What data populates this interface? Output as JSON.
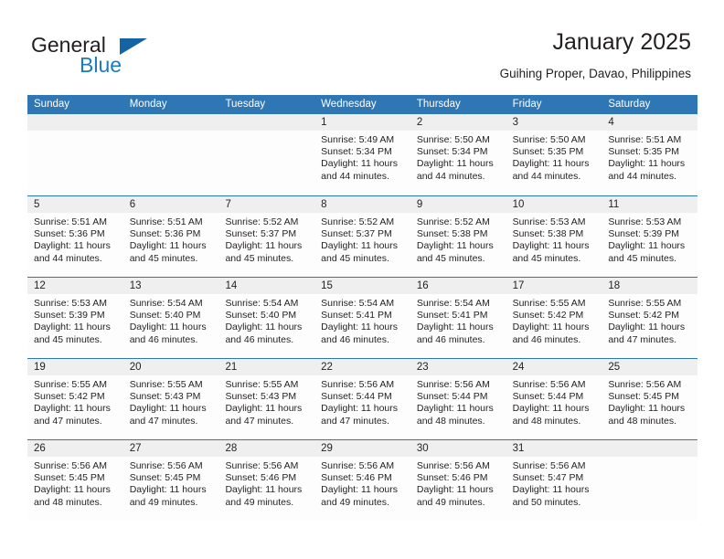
{
  "logo": {
    "word_one": "General",
    "word_two": "Blue",
    "mark": "triangle-icon"
  },
  "header": {
    "title": "January 2025",
    "subtitle": "Guihing Proper, Davao, Philippines"
  },
  "calendar": {
    "weekdays": [
      "Sunday",
      "Monday",
      "Tuesday",
      "Wednesday",
      "Thursday",
      "Friday",
      "Saturday"
    ],
    "labels": {
      "sunrise": "Sunrise:",
      "sunset": "Sunset:",
      "daylight": "Daylight:"
    },
    "colors": {
      "header_blue": "#2f76b5",
      "day_number_bar": "#efefef",
      "text": "#231f20",
      "logo_blue": "#1c7ac0"
    },
    "weeks": [
      [
        {
          "day": "",
          "empty": true
        },
        {
          "day": "",
          "empty": true
        },
        {
          "day": "",
          "empty": true
        },
        {
          "day": "1",
          "sunrise": "Sunrise: 5:49 AM",
          "sunset": "Sunset: 5:34 PM",
          "daylight": "Daylight: 11 hours and 44 minutes."
        },
        {
          "day": "2",
          "sunrise": "Sunrise: 5:50 AM",
          "sunset": "Sunset: 5:34 PM",
          "daylight": "Daylight: 11 hours and 44 minutes."
        },
        {
          "day": "3",
          "sunrise": "Sunrise: 5:50 AM",
          "sunset": "Sunset: 5:35 PM",
          "daylight": "Daylight: 11 hours and 44 minutes."
        },
        {
          "day": "4",
          "sunrise": "Sunrise: 5:51 AM",
          "sunset": "Sunset: 5:35 PM",
          "daylight": "Daylight: 11 hours and 44 minutes."
        }
      ],
      [
        {
          "day": "5",
          "sunrise": "Sunrise: 5:51 AM",
          "sunset": "Sunset: 5:36 PM",
          "daylight": "Daylight: 11 hours and 44 minutes."
        },
        {
          "day": "6",
          "sunrise": "Sunrise: 5:51 AM",
          "sunset": "Sunset: 5:36 PM",
          "daylight": "Daylight: 11 hours and 45 minutes."
        },
        {
          "day": "7",
          "sunrise": "Sunrise: 5:52 AM",
          "sunset": "Sunset: 5:37 PM",
          "daylight": "Daylight: 11 hours and 45 minutes."
        },
        {
          "day": "8",
          "sunrise": "Sunrise: 5:52 AM",
          "sunset": "Sunset: 5:37 PM",
          "daylight": "Daylight: 11 hours and 45 minutes."
        },
        {
          "day": "9",
          "sunrise": "Sunrise: 5:52 AM",
          "sunset": "Sunset: 5:38 PM",
          "daylight": "Daylight: 11 hours and 45 minutes."
        },
        {
          "day": "10",
          "sunrise": "Sunrise: 5:53 AM",
          "sunset": "Sunset: 5:38 PM",
          "daylight": "Daylight: 11 hours and 45 minutes."
        },
        {
          "day": "11",
          "sunrise": "Sunrise: 5:53 AM",
          "sunset": "Sunset: 5:39 PM",
          "daylight": "Daylight: 11 hours and 45 minutes."
        }
      ],
      [
        {
          "day": "12",
          "sunrise": "Sunrise: 5:53 AM",
          "sunset": "Sunset: 5:39 PM",
          "daylight": "Daylight: 11 hours and 45 minutes."
        },
        {
          "day": "13",
          "sunrise": "Sunrise: 5:54 AM",
          "sunset": "Sunset: 5:40 PM",
          "daylight": "Daylight: 11 hours and 46 minutes."
        },
        {
          "day": "14",
          "sunrise": "Sunrise: 5:54 AM",
          "sunset": "Sunset: 5:40 PM",
          "daylight": "Daylight: 11 hours and 46 minutes."
        },
        {
          "day": "15",
          "sunrise": "Sunrise: 5:54 AM",
          "sunset": "Sunset: 5:41 PM",
          "daylight": "Daylight: 11 hours and 46 minutes."
        },
        {
          "day": "16",
          "sunrise": "Sunrise: 5:54 AM",
          "sunset": "Sunset: 5:41 PM",
          "daylight": "Daylight: 11 hours and 46 minutes."
        },
        {
          "day": "17",
          "sunrise": "Sunrise: 5:55 AM",
          "sunset": "Sunset: 5:42 PM",
          "daylight": "Daylight: 11 hours and 46 minutes."
        },
        {
          "day": "18",
          "sunrise": "Sunrise: 5:55 AM",
          "sunset": "Sunset: 5:42 PM",
          "daylight": "Daylight: 11 hours and 47 minutes."
        }
      ],
      [
        {
          "day": "19",
          "sunrise": "Sunrise: 5:55 AM",
          "sunset": "Sunset: 5:42 PM",
          "daylight": "Daylight: 11 hours and 47 minutes."
        },
        {
          "day": "20",
          "sunrise": "Sunrise: 5:55 AM",
          "sunset": "Sunset: 5:43 PM",
          "daylight": "Daylight: 11 hours and 47 minutes."
        },
        {
          "day": "21",
          "sunrise": "Sunrise: 5:55 AM",
          "sunset": "Sunset: 5:43 PM",
          "daylight": "Daylight: 11 hours and 47 minutes."
        },
        {
          "day": "22",
          "sunrise": "Sunrise: 5:56 AM",
          "sunset": "Sunset: 5:44 PM",
          "daylight": "Daylight: 11 hours and 47 minutes."
        },
        {
          "day": "23",
          "sunrise": "Sunrise: 5:56 AM",
          "sunset": "Sunset: 5:44 PM",
          "daylight": "Daylight: 11 hours and 48 minutes."
        },
        {
          "day": "24",
          "sunrise": "Sunrise: 5:56 AM",
          "sunset": "Sunset: 5:44 PM",
          "daylight": "Daylight: 11 hours and 48 minutes."
        },
        {
          "day": "25",
          "sunrise": "Sunrise: 5:56 AM",
          "sunset": "Sunset: 5:45 PM",
          "daylight": "Daylight: 11 hours and 48 minutes."
        }
      ],
      [
        {
          "day": "26",
          "sunrise": "Sunrise: 5:56 AM",
          "sunset": "Sunset: 5:45 PM",
          "daylight": "Daylight: 11 hours and 48 minutes."
        },
        {
          "day": "27",
          "sunrise": "Sunrise: 5:56 AM",
          "sunset": "Sunset: 5:45 PM",
          "daylight": "Daylight: 11 hours and 49 minutes."
        },
        {
          "day": "28",
          "sunrise": "Sunrise: 5:56 AM",
          "sunset": "Sunset: 5:46 PM",
          "daylight": "Daylight: 11 hours and 49 minutes."
        },
        {
          "day": "29",
          "sunrise": "Sunrise: 5:56 AM",
          "sunset": "Sunset: 5:46 PM",
          "daylight": "Daylight: 11 hours and 49 minutes."
        },
        {
          "day": "30",
          "sunrise": "Sunrise: 5:56 AM",
          "sunset": "Sunset: 5:46 PM",
          "daylight": "Daylight: 11 hours and 49 minutes."
        },
        {
          "day": "31",
          "sunrise": "Sunrise: 5:56 AM",
          "sunset": "Sunset: 5:47 PM",
          "daylight": "Daylight: 11 hours and 50 minutes."
        },
        {
          "day": "",
          "empty": true
        }
      ]
    ]
  }
}
